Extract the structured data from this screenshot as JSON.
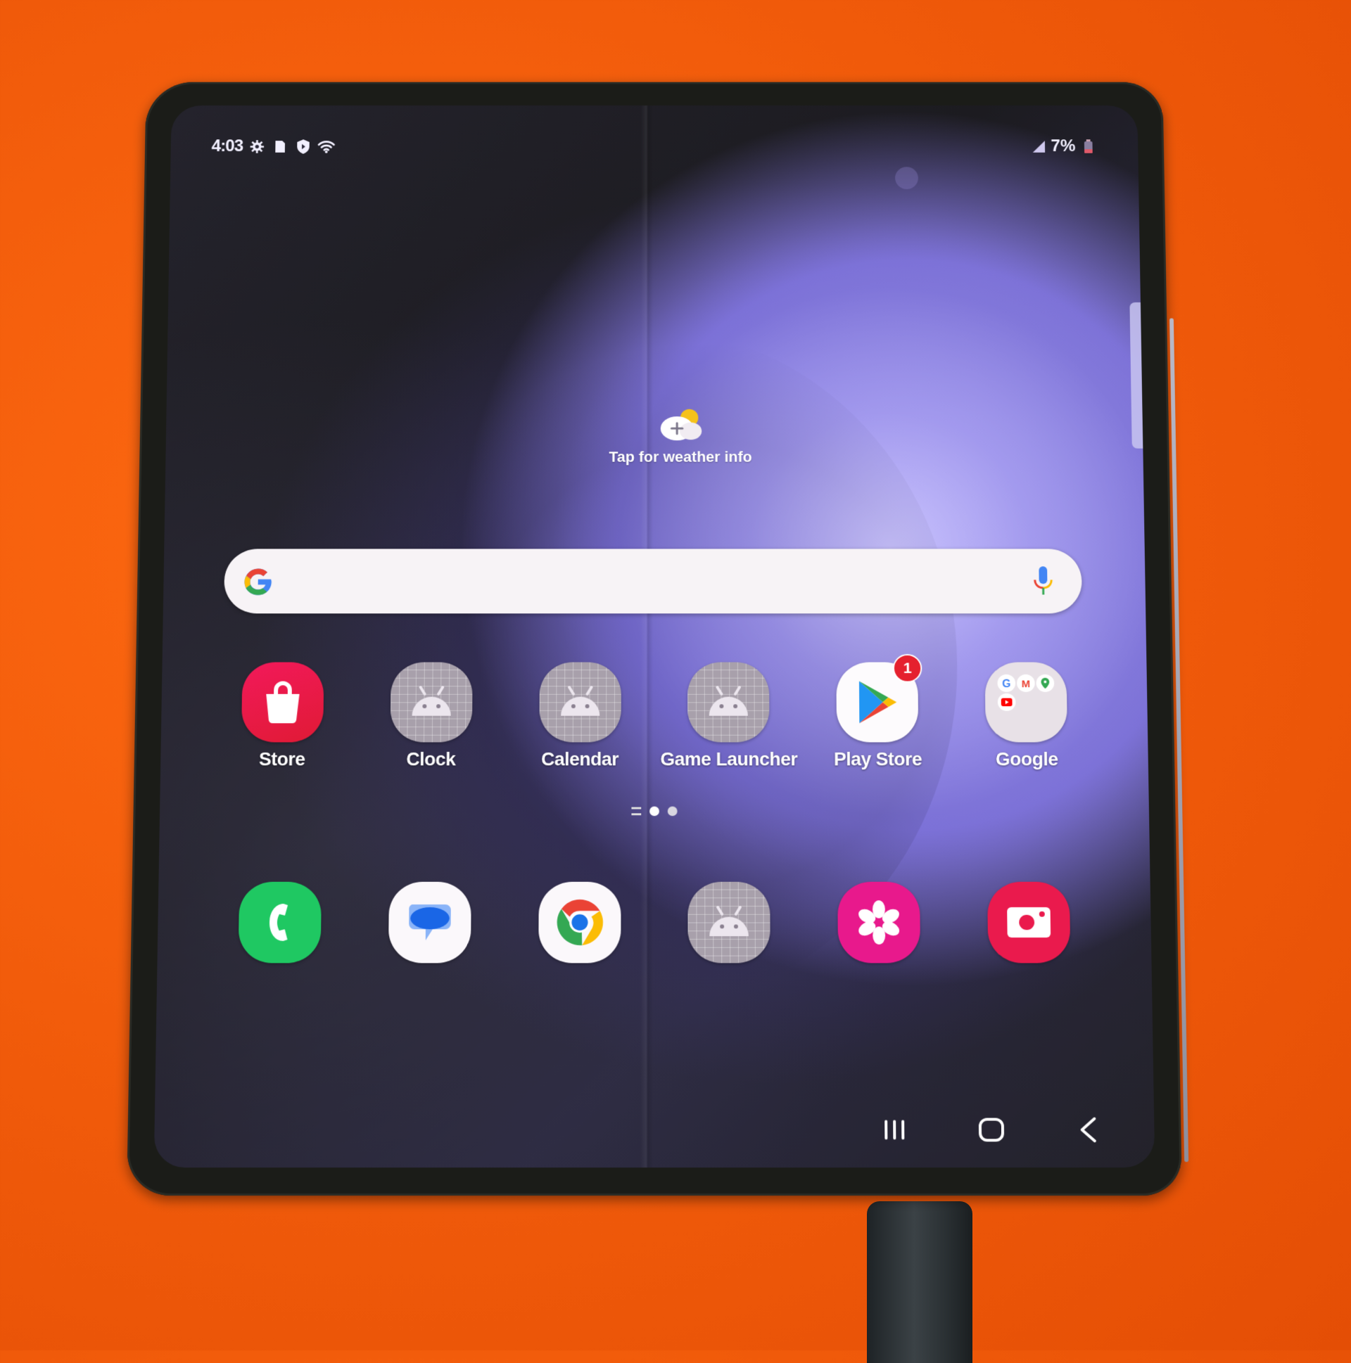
{
  "status_bar": {
    "time": "4:03",
    "left_icons": [
      "settings-gear-icon",
      "sim-card-icon",
      "shield-icon",
      "wifi-icon"
    ],
    "right_icons": [
      "signal-icon",
      "battery-icon"
    ],
    "battery_percent": "7%"
  },
  "weather_widget": {
    "icon": "cloud-plus-sun-icon",
    "label": "Tap for weather info"
  },
  "search_bar": {
    "logo": "google-g-icon",
    "mic": "microphone-icon"
  },
  "home_apps": [
    {
      "label": "Store",
      "icon": "shopping-bag-icon",
      "color": "#e8174a"
    },
    {
      "label": "Clock",
      "icon": "android-placeholder-icon",
      "color": "#a8a0ab"
    },
    {
      "label": "Calendar",
      "icon": "android-placeholder-icon",
      "color": "#a8a0ab"
    },
    {
      "label": "Game Launcher",
      "icon": "android-placeholder-icon",
      "color": "#a8a0ab"
    },
    {
      "label": "Play Store",
      "icon": "play-store-icon",
      "color": "#ffffff",
      "badge": "1"
    },
    {
      "label": "Google",
      "icon": "google-folder-icon",
      "color": "#e6e0e6"
    }
  ],
  "page_indicator": {
    "pages": 2,
    "active_page": 1
  },
  "dock_apps": [
    {
      "name": "Phone",
      "icon": "phone-icon",
      "color": "#1ec760"
    },
    {
      "name": "Messages",
      "icon": "messages-bubble-icon",
      "color": "#ffffff"
    },
    {
      "name": "Chrome",
      "icon": "chrome-icon",
      "color": "#ffffff"
    },
    {
      "name": "App",
      "icon": "android-placeholder-icon",
      "color": "#a8a0ab"
    },
    {
      "name": "Gallery",
      "icon": "gallery-flower-icon",
      "color": "#e81a8c"
    },
    {
      "name": "Camera",
      "icon": "camera-icon",
      "color": "#e8174a"
    }
  ],
  "nav_bar": {
    "recents": "recents-icon",
    "home": "home-icon",
    "back": "back-icon"
  }
}
